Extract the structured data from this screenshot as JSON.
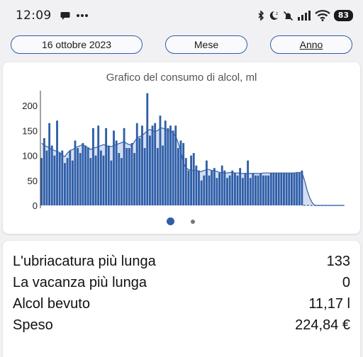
{
  "status_bar": {
    "time": "12:09",
    "battery": "83",
    "icons": [
      "chat-icon",
      "more-icon",
      "bluetooth-icon",
      "do-not-disturb-icon",
      "mute-icon",
      "signal-icon",
      "wifi-icon",
      "battery-icon"
    ]
  },
  "controls": {
    "date_label": "16 ottobre 2023",
    "month_label": "Mese",
    "year_label": "Anno"
  },
  "chart": {
    "title": "Grafico del consumo di alcol, ml",
    "accent_color": "#2f5ea8",
    "area_color": "#c5d3ea"
  },
  "chart_data": {
    "type": "bar",
    "title": "Grafico del consumo di alcol, ml",
    "ylim": [
      0,
      230
    ],
    "yticks": [
      "0",
      "50",
      "100",
      "150",
      "200"
    ],
    "grid": false,
    "values": [
      95,
      135,
      110,
      165,
      120,
      100,
      170,
      105,
      110,
      85,
      95,
      110,
      90,
      130,
      115,
      105,
      125,
      120,
      115,
      95,
      155,
      100,
      160,
      110,
      100,
      155,
      120,
      90,
      150,
      130,
      105,
      95,
      155,
      115,
      115,
      125,
      105,
      165,
      135,
      160,
      115,
      225,
      140,
      160,
      165,
      115,
      180,
      120,
      170,
      155,
      160,
      150,
      160,
      115,
      130,
      125,
      95,
      70,
      100,
      105,
      80,
      70,
      50,
      60,
      90,
      60,
      70,
      75,
      55,
      65,
      80,
      70,
      55,
      60,
      70,
      65,
      60,
      75,
      55,
      65,
      90,
      55,
      65,
      60,
      60,
      65,
      60,
      60,
      60,
      65,
      65,
      65,
      65,
      65,
      65,
      65,
      65,
      65,
      65,
      65,
      65,
      70,
      0,
      0,
      0,
      0,
      0,
      0,
      0,
      0,
      0,
      0,
      0,
      0,
      0,
      0,
      0,
      0
    ],
    "average_area": [
      125,
      120,
      118,
      115,
      112,
      110,
      108,
      106,
      100,
      98,
      105,
      110,
      112,
      115,
      118,
      120,
      122,
      118,
      116,
      112,
      115,
      116,
      118,
      120,
      122,
      120,
      118,
      118,
      120,
      122,
      124,
      126,
      128,
      124,
      122,
      120,
      128,
      135,
      138,
      140,
      145,
      150,
      152,
      150,
      148,
      150,
      155,
      155,
      152,
      150,
      150,
      145,
      138,
      125,
      108,
      85,
      75,
      72,
      70,
      70,
      70,
      68,
      68,
      70,
      72,
      72,
      70,
      70,
      68,
      66,
      66,
      65,
      65,
      66,
      66,
      65,
      65,
      64,
      64,
      64,
      64,
      64,
      64,
      64,
      64,
      64,
      65,
      65,
      65,
      65,
      65,
      65,
      65,
      65,
      65,
      65,
      65,
      65,
      65,
      66,
      66,
      66,
      50,
      30,
      15,
      5,
      0,
      0,
      0,
      0,
      0,
      0,
      0,
      0,
      0,
      0,
      0,
      0
    ]
  },
  "stats": [
    {
      "label": "L'ubriacatura più lunga",
      "value": "133"
    },
    {
      "label": "La vacanza più lunga",
      "value": "0"
    },
    {
      "label": "Alcol bevuto",
      "value": "11,17 l"
    },
    {
      "label": "Speso",
      "value": "224,84 €"
    }
  ]
}
